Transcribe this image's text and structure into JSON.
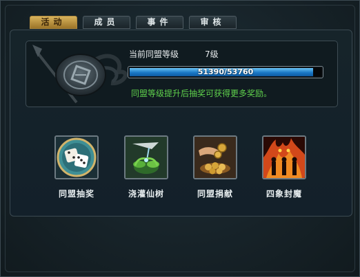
{
  "tabs": [
    {
      "label": "活动",
      "active": true
    },
    {
      "label": "成员",
      "active": false
    },
    {
      "label": "事件",
      "active": false
    },
    {
      "label": "审核",
      "active": false
    }
  ],
  "alliance": {
    "level_label": "当前同盟等级",
    "level_value": "7级",
    "progress_text": "51390/53760",
    "progress_current": 51390,
    "progress_max": 53760,
    "hint": "同盟等级提升后抽奖可获得更多奖励。"
  },
  "activities": [
    {
      "label": "同盟抽奖",
      "icon": "dice-icon"
    },
    {
      "label": "浇灌仙树",
      "icon": "watering-tree-icon"
    },
    {
      "label": "同盟捐献",
      "icon": "coins-donation-icon"
    },
    {
      "label": "四象封魔",
      "icon": "fire-demon-icon"
    }
  ],
  "colors": {
    "tab_active": "#c9a24a",
    "progress_fill": "#2a8ee0",
    "hint_text": "#5fd04c"
  }
}
